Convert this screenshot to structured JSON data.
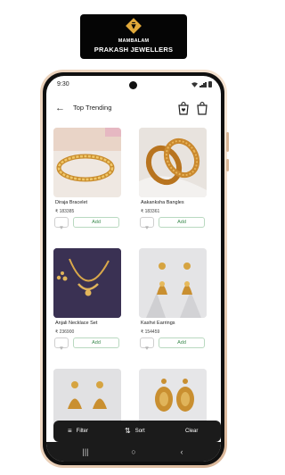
{
  "brand": {
    "line1": "MAMBALAM",
    "line2": "PRAKASH JEWELLERS",
    "logo": "diamond-logo"
  },
  "status": {
    "time": "9:30"
  },
  "header": {
    "title": "Top Trending",
    "back_icon": "arrow-left-icon",
    "icons": [
      "shopping-bag-heart-icon",
      "shopping-bag-icon"
    ]
  },
  "products": [
    {
      "name": "Diraja Bracelet",
      "price": "₹ 183385",
      "add_label": "Add",
      "image": "gold-bracelet"
    },
    {
      "name": "Aakanksha Bangles",
      "price": "₹ 183361",
      "add_label": "Add",
      "image": "gold-bangles"
    },
    {
      "name": "Anjali Necklace Set",
      "price": "₹ 236900",
      "add_label": "Add",
      "image": "gold-necklace"
    },
    {
      "name": "Kashvi Earrings",
      "price": "₹ 154459",
      "add_label": "Add",
      "image": "gold-jhumka"
    },
    {
      "name": "",
      "price": "",
      "add_label": "",
      "image": "gold-earrings-stack"
    },
    {
      "name": "",
      "price": "",
      "add_label": "",
      "image": "gold-drop-earrings"
    }
  ],
  "bottom_bar": {
    "filter": "Filter",
    "sort": "Sort",
    "clear": "Clear"
  },
  "colors": {
    "add_green": "#3a8a4d",
    "bar_dark": "#1b1b1b",
    "gold": "#d4a24c"
  }
}
